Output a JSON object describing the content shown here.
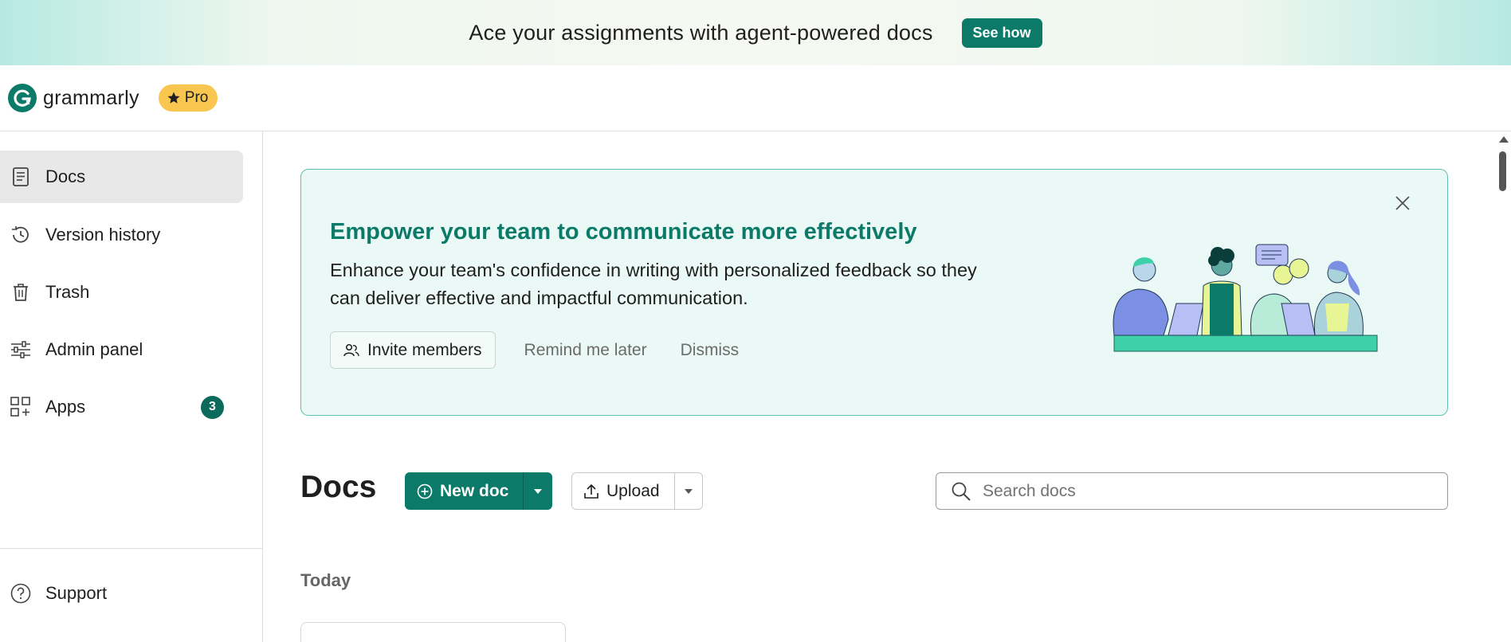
{
  "banner": {
    "message": "Ace your assignments with agent-powered docs",
    "cta": "See how"
  },
  "header": {
    "brand": "grammarly",
    "plan_badge": "Pro"
  },
  "sidebar": {
    "items": [
      {
        "label": "Docs",
        "icon": "document-icon",
        "active": true
      },
      {
        "label": "Version history",
        "icon": "history-icon"
      },
      {
        "label": "Trash",
        "icon": "trash-icon"
      },
      {
        "label": "Admin panel",
        "icon": "sliders-icon"
      },
      {
        "label": "Apps",
        "icon": "apps-icon",
        "count": "3"
      }
    ],
    "support": {
      "label": "Support",
      "icon": "help-icon"
    }
  },
  "promo": {
    "title": "Empower your team to communicate more effectively",
    "description": "Enhance your team's confidence in writing with personalized feedback so they can deliver effective and impactful communication.",
    "invite_label": "Invite members",
    "remind_label": "Remind me later",
    "dismiss_label": "Dismiss"
  },
  "docs": {
    "title": "Docs",
    "new_doc_label": "New doc",
    "upload_label": "Upload",
    "search_placeholder": "Search docs",
    "section_today": "Today"
  },
  "colors": {
    "brand": "#0b7a68",
    "badge": "#f9c74f",
    "promo_bg": "#ebf9f6"
  }
}
